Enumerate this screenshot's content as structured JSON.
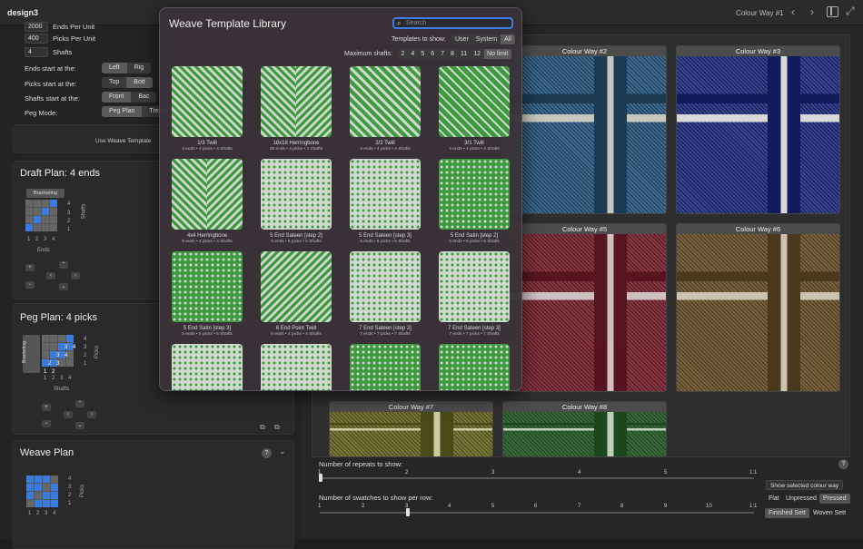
{
  "app": {
    "title": "design3",
    "colour_way_indicator": "Colour Way #1"
  },
  "sidebar": {
    "top_rows": [
      {
        "value": "2000",
        "label": "Ends Per Unit"
      },
      {
        "value": "400",
        "label": "Picks Per Unit"
      },
      {
        "value": "4",
        "label": "Shafts"
      }
    ],
    "ends_start": {
      "label": "Ends start at the:",
      "options": [
        "Left",
        "Rig"
      ],
      "selected": 0
    },
    "picks_start": {
      "label": "Picks start at the:",
      "options": [
        "Top",
        "Bott"
      ],
      "selected": 1
    },
    "shafts_start": {
      "label": "Shafts start at the:",
      "options": [
        "Front",
        "Bac"
      ],
      "selected": 0
    },
    "peg_mode": {
      "label": "Peg Mode:",
      "options": [
        "Peg Plan",
        "Tread"
      ],
      "selected": 0
    },
    "use_template": "Use Weave Template",
    "draft_plan": {
      "title": "Draft Plan:  4 ends",
      "bracketing": "Bracketing",
      "shafts_label": "Shafts",
      "ends_label": "Ends",
      "row_nums": [
        "4",
        "3",
        "2",
        "1"
      ],
      "col_nums": [
        "1",
        "2",
        "3",
        "4"
      ]
    },
    "peg_plan": {
      "title": "Peg Plan:  4 picks",
      "bracketing": "Bracketing",
      "picks_label": "Picks",
      "shafts_label": "Shafts",
      "row_nums": [
        "4",
        "3",
        "2",
        "1"
      ],
      "col_nums": [
        "1",
        "2",
        "3",
        "4"
      ],
      "cell_nums": [
        "3",
        "4",
        "3",
        "4",
        "2",
        "3",
        "1",
        "2"
      ]
    },
    "weave_plan": {
      "title": "Weave Plan",
      "picks_label": "Picks",
      "help": "?",
      "row_nums": [
        "4",
        "3",
        "2",
        "1"
      ],
      "col_nums": [
        "1",
        "2",
        "3",
        "4"
      ]
    }
  },
  "colourways": [
    {
      "label": "Colour Way #2",
      "base": "#3f6e94",
      "stripe": "#d0d0c8",
      "dark": "#1c3b55"
    },
    {
      "label": "Colour Way #3",
      "base": "#3a4590",
      "stripe": "#e2e2e2",
      "dark": "#101c60"
    },
    {
      "label": "Colour Way #5",
      "base": "#8a3a44",
      "stripe": "#d8c8c8",
      "dark": "#5a1420"
    },
    {
      "label": "Colour Way #6",
      "base": "#7c6440",
      "stripe": "#d4ccb8",
      "dark": "#4c3a1c"
    },
    {
      "label": "Colour Way #7",
      "base": "#7c7a3a",
      "stripe": "#d4d4a8",
      "dark": "#4c4c18"
    },
    {
      "label": "Colour Way #8",
      "base": "#3a6a3c",
      "stripe": "#c8d8c0",
      "dark": "#1a4a1c"
    }
  ],
  "bottom": {
    "repeats": {
      "label": "Number of repeats to show:",
      "ticks": [
        "1",
        "2",
        "3",
        "4",
        "5",
        "1:1"
      ],
      "value": "1"
    },
    "per_row": {
      "label": "Number of swatches to show per row:",
      "ticks": [
        "1",
        "2",
        "3",
        "4",
        "5",
        "6",
        "7",
        "8",
        "9",
        "10",
        "1:1"
      ],
      "value": "3"
    },
    "help": "?",
    "show_selected": "Show selected colour way",
    "finish": [
      "Flat",
      "Unpressed",
      "Pressed"
    ],
    "finish_selected": 2,
    "sett": [
      "Finished Sett",
      "Woven Sett"
    ],
    "sett_selected": 0
  },
  "library": {
    "title": "Weave Template Library",
    "search_placeholder": "Search",
    "templates_label": "Templates to show:",
    "template_options": [
      "User",
      "System",
      "All"
    ],
    "template_selected": 2,
    "max_shafts_label": "Maximum shafts:",
    "max_shafts_options": [
      "2",
      "4",
      "5",
      "6",
      "7",
      "8",
      "11",
      "12",
      "No limit"
    ],
    "max_selected": 8,
    "items": [
      {
        "name": "1/3 Twill",
        "meta": "4 ends • 4 picks • 4 Shafts",
        "pattern": "twill"
      },
      {
        "name": "18x18 Herringbone",
        "meta": "36 ends • 4 picks • 4 Shafts",
        "pattern": "herring"
      },
      {
        "name": "2/2 Twill",
        "meta": "4 ends • 4 picks • 4 Shafts",
        "pattern": "twill22"
      },
      {
        "name": "3/1 Twill",
        "meta": "4 ends • 4 picks • 4 Shafts",
        "pattern": "twill31"
      },
      {
        "name": "4x4 Herringbone",
        "meta": "8 ends • 4 picks • 4 Shafts",
        "pattern": "herring4"
      },
      {
        "name": "5 End Sateen [step 2]",
        "meta": "5 ends • 5 picks • 5 Shafts",
        "pattern": "sateen"
      },
      {
        "name": "5 End Sateen [step 3]",
        "meta": "5 ends • 5 picks • 5 Shafts",
        "pattern": "sateen"
      },
      {
        "name": "5 End Satin [step 2]",
        "meta": "5 ends • 5 picks • 5 Shafts",
        "pattern": "satin"
      },
      {
        "name": "5 End Satin [step 3]",
        "meta": "5 ends • 5 picks • 5 Shafts",
        "pattern": "satin"
      },
      {
        "name": "6 End Point Twill",
        "meta": "6 ends • 4 picks • 4 Shafts",
        "pattern": "point"
      },
      {
        "name": "7 End Sateen [step 2]",
        "meta": "7 ends • 7 picks • 7 Shafts",
        "pattern": "sateen"
      },
      {
        "name": "7 End Sateen [step 3]",
        "meta": "7 ends • 7 picks • 7 Shafts",
        "pattern": "sateen"
      },
      {
        "name": "",
        "meta": "",
        "pattern": "sateen"
      },
      {
        "name": "",
        "meta": "",
        "pattern": "sateen"
      },
      {
        "name": "",
        "meta": "",
        "pattern": "satin"
      },
      {
        "name": "",
        "meta": "",
        "pattern": "satin"
      }
    ]
  }
}
